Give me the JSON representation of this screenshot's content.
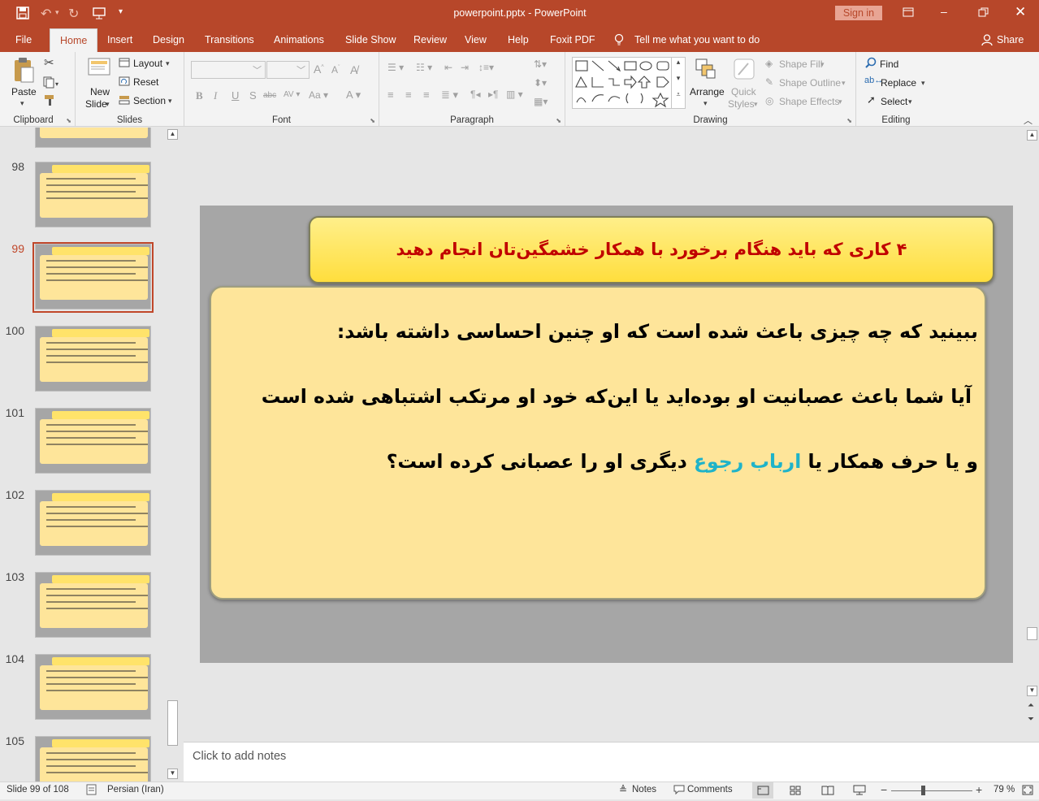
{
  "titlebar": {
    "document_title": "powerpoint.pptx  -  PowerPoint",
    "sign_in_label": "Sign in"
  },
  "tabs": [
    {
      "label": "File"
    },
    {
      "label": "Home"
    },
    {
      "label": "Insert"
    },
    {
      "label": "Design"
    },
    {
      "label": "Transitions"
    },
    {
      "label": "Animations"
    },
    {
      "label": "Slide Show"
    },
    {
      "label": "Review"
    },
    {
      "label": "View"
    },
    {
      "label": "Help"
    },
    {
      "label": "Foxit PDF"
    }
  ],
  "tell_me": "Tell me what you want to do",
  "share_label": "Share",
  "ribbon": {
    "clipboard": {
      "paste": "Paste",
      "group": "Clipboard"
    },
    "slides": {
      "new_slide_1": "New",
      "new_slide_2": "Slide",
      "layout": "Layout",
      "reset": "Reset",
      "section": "Section",
      "group": "Slides"
    },
    "font": {
      "group": "Font"
    },
    "paragraph": {
      "group": "Paragraph"
    },
    "drawing": {
      "arrange": "Arrange",
      "quick_styles_1": "Quick",
      "quick_styles_2": "Styles",
      "shape_fill": "Shape Fill",
      "shape_outline": "Shape Outline",
      "shape_effects": "Shape Effects",
      "group": "Drawing"
    },
    "editing": {
      "find": "Find",
      "replace": "Replace",
      "select": "Select",
      "group": "Editing"
    }
  },
  "thumbnails": [
    {
      "number": "98"
    },
    {
      "number": "99",
      "selected": true
    },
    {
      "number": "100"
    },
    {
      "number": "101"
    },
    {
      "number": "102"
    },
    {
      "number": "103"
    },
    {
      "number": "104"
    },
    {
      "number": "105"
    }
  ],
  "slide": {
    "title": "۴ کاری که باید هنگام برخورد با همکار خشمگین‌تان انجام دهید",
    "line1": "ببینید که چه چیزی باعث شده است که او چنین احساسی داشته باشد:",
    "line2": "آیا شما باعث عصبانیت او بوده‌اید یا این‌که خود او مرتکب اشتباهی شده است",
    "line3_part1": "و یا حرف همکار یا",
    "line3_highlight": "ارباب رجوع",
    "line3_part2": "دیگری او را عصبانی کرده است؟",
    "title_color": "#c00000",
    "highlight_color": "#1fb3c9"
  },
  "notes_placeholder": "Click to add notes",
  "statusbar": {
    "slide_info": "Slide 99 of 108",
    "language": "Persian (Iran)",
    "notes": "Notes",
    "comments": "Comments",
    "zoom": "79 %"
  }
}
